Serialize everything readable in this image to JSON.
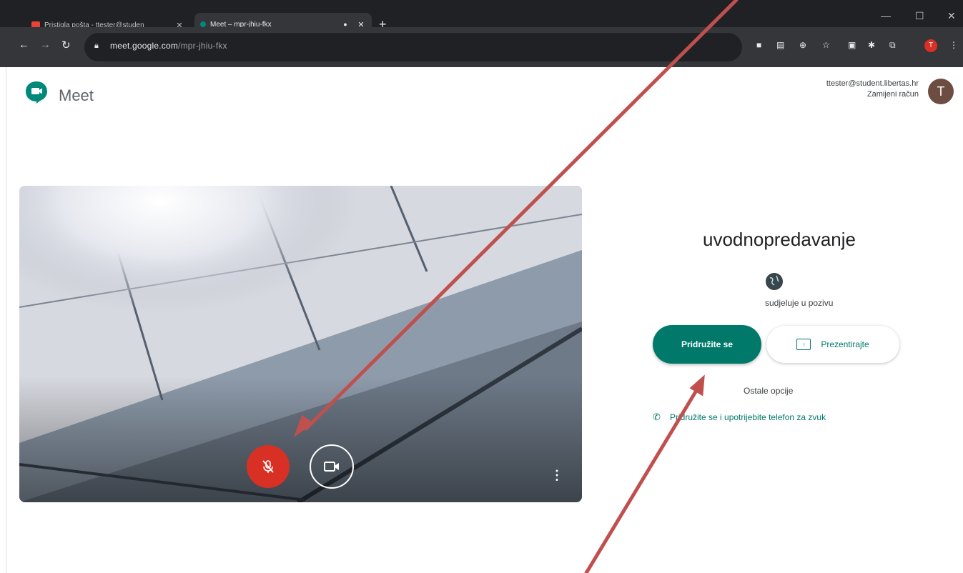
{
  "browser": {
    "tabs": [
      {
        "label": "Pristigla pošta - ttester@studen",
        "active": false,
        "favicon": "gmail-icon"
      },
      {
        "label": "Meet – mpr-jhiu-fkx",
        "active": true,
        "favicon": "meet-icon"
      }
    ],
    "url_host": "meet.google.com",
    "url_path": "/mpr-jhiu-fkx",
    "profile_initial": "T"
  },
  "header": {
    "app_name": "Meet",
    "account_email": "ttester@student.libertas.hr",
    "switch_account": "Zamijeni račun",
    "avatar_initial": "T"
  },
  "join_panel": {
    "room_name": "uvodnopredavanje",
    "participant_status": "sudjeluje u pozivu",
    "join_button": "Pridružite se",
    "present_button": "Prezentirajte",
    "other_options": "Ostale opcije",
    "phone_join": "Pridružite se i upotrijebite telefon za zvuk"
  },
  "video": {
    "mic_state": "muted",
    "more_label": "⋮"
  },
  "colors": {
    "accent": "#00796b",
    "mute_red": "#d93025",
    "annotation_arrow": "#c0504d"
  }
}
